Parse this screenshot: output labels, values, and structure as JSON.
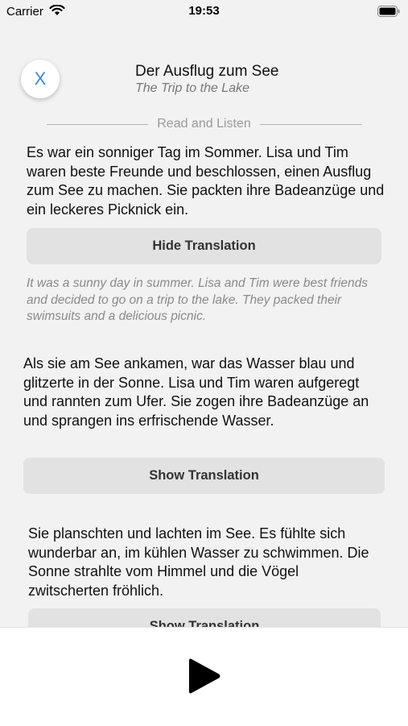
{
  "status_bar": {
    "carrier": "Carrier",
    "time": "19:53"
  },
  "header": {
    "close_label": "X",
    "title": "Der Ausflug zum See",
    "subtitle": "The Trip to the Lake"
  },
  "section": {
    "label": "Read and Listen"
  },
  "paragraphs": [
    {
      "text": "Es war ein sonniger Tag im Sommer. Lisa und Tim waren beste Freunde und beschlossen, einen Ausflug zum See zu machen. Sie packten ihre Badeanzüge und ein leckeres Picknick ein.",
      "button_label": "Hide Translation",
      "translation": "It was a sunny day in summer. Lisa and Tim were best friends and decided to go on a trip to the lake. They packed their swimsuits and a delicious picnic."
    },
    {
      "text": "Als sie am See ankamen, war das Wasser blau und glitzerte in der Sonne. Lisa und Tim waren aufgeregt und rannten zum Ufer. Sie zogen ihre Badeanzüge an und sprangen ins erfrischende Wasser.",
      "button_label": "Show Translation"
    },
    {
      "text": "Sie planschten und lachten im See. Es fühlte sich wunderbar an, im kühlen Wasser zu schwimmen. Die Sonne strahlte vom Himmel und die Vögel zwitscherten fröhlich.",
      "button_label": "Show Translation"
    }
  ],
  "player": {
    "play_icon": "play-icon"
  }
}
